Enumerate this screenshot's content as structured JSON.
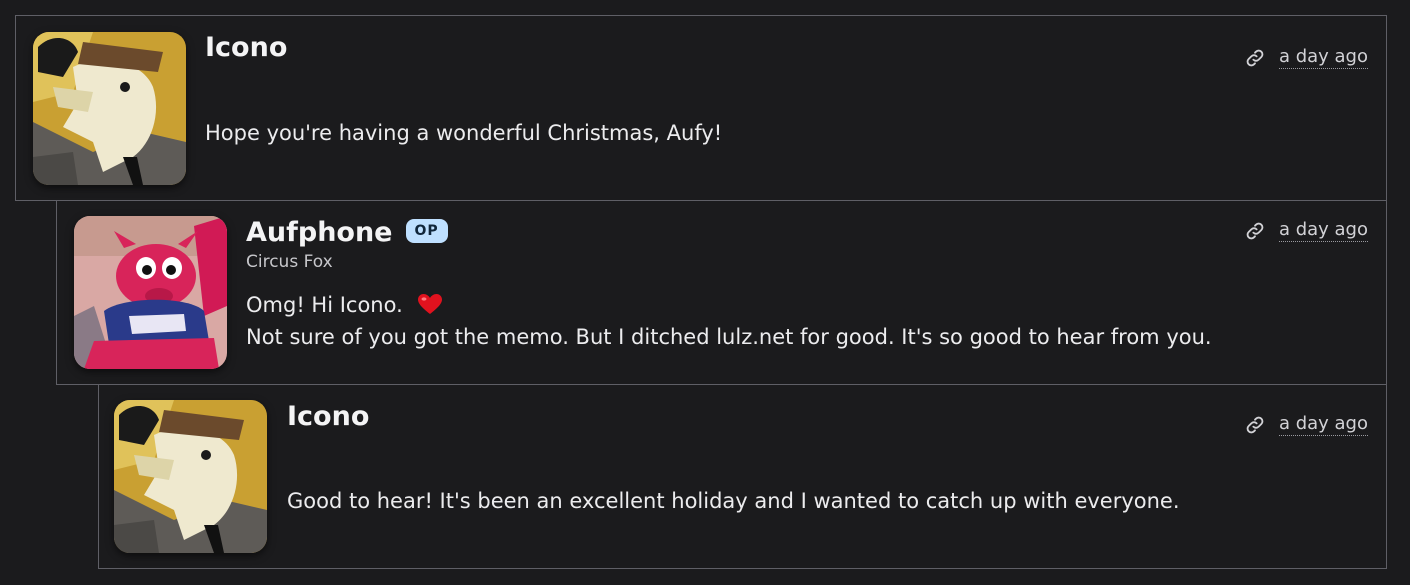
{
  "colors": {
    "background": "#1b1b1d",
    "border": "#5f5f66",
    "op_badge_bg": "#bfe0ff",
    "heart": "#e1121e"
  },
  "comments": [
    {
      "author": "Icono",
      "avatar_icon": "eagle-avatar-icon",
      "timestamp": "a day ago",
      "lines": [
        "Hope you're having a wonderful Christmas, Aufy!"
      ]
    },
    {
      "author": "Aufphone",
      "badge": "OP",
      "subtitle": "Circus Fox",
      "avatar_icon": "fox-plush-avatar-icon",
      "timestamp": "a day ago",
      "lines": [
        "Omg! Hi Icono.",
        "Not sure of you got the memo. But I ditched lulz.net for good. It's so good to hear from you."
      ],
      "emoji": "heart-icon"
    },
    {
      "author": "Icono",
      "avatar_icon": "eagle-avatar-icon",
      "timestamp": "a day ago",
      "lines": [
        "Good to hear! It's been an excellent holiday and I wanted to catch up with everyone."
      ]
    }
  ]
}
